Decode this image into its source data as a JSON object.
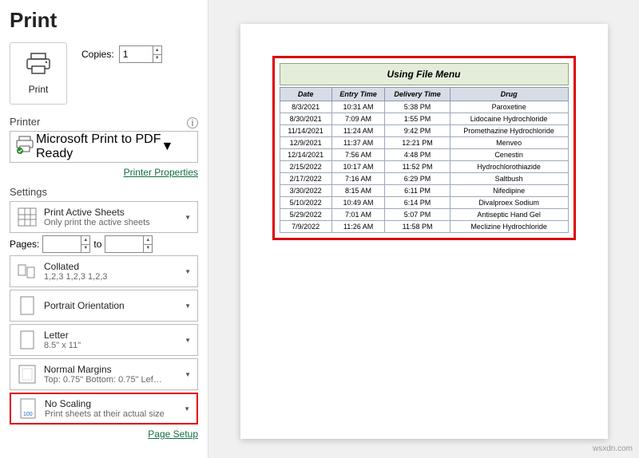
{
  "title": "Print",
  "print_button": "Print",
  "copies_label": "Copies:",
  "copies_value": "1",
  "printer_section": "Printer",
  "printer": {
    "name": "Microsoft Print to PDF",
    "status": "Ready"
  },
  "printer_properties_link": "Printer Properties",
  "settings_section": "Settings",
  "active_sheets": {
    "title": "Print Active Sheets",
    "sub": "Only print the active sheets"
  },
  "pages_label": "Pages:",
  "pages_to": "to",
  "collated": {
    "title": "Collated",
    "sub": "1,2,3   1,2,3   1,2,3"
  },
  "orientation": {
    "title": "Portrait Orientation"
  },
  "paper": {
    "title": "Letter",
    "sub": "8.5\" x 11\""
  },
  "margins": {
    "title": "Normal Margins",
    "sub": "Top: 0.75\" Bottom: 0.75\" Lef…"
  },
  "scaling": {
    "title": "No Scaling",
    "sub": "Print sheets at their actual size"
  },
  "page_setup_link": "Page Setup",
  "preview": {
    "title": "Using File Menu",
    "headers": [
      "Date",
      "Entry Time",
      "Delivery Time",
      "Drug"
    ],
    "rows": [
      [
        "8/3/2021",
        "10:31 AM",
        "5:38 PM",
        "Paroxetine"
      ],
      [
        "8/30/2021",
        "7:09 AM",
        "1:55 PM",
        "Lidocaine Hydrochloride"
      ],
      [
        "11/14/2021",
        "11:24 AM",
        "9:42 PM",
        "Promethazine Hydrochloride"
      ],
      [
        "12/9/2021",
        "11:37 AM",
        "12:21 PM",
        "Menveo"
      ],
      [
        "12/14/2021",
        "7:56 AM",
        "4:48 PM",
        "Cenestin"
      ],
      [
        "2/15/2022",
        "10:17 AM",
        "11:52 PM",
        "Hydrochlorothiazide"
      ],
      [
        "2/17/2022",
        "7:16 AM",
        "6:29 PM",
        "Saltbush"
      ],
      [
        "3/30/2022",
        "8:15 AM",
        "6:11 PM",
        "Nifedipine"
      ],
      [
        "5/10/2022",
        "10:49 AM",
        "6:14 PM",
        "Divalproex Sodium"
      ],
      [
        "5/29/2022",
        "7:01 AM",
        "5:07 PM",
        "Antiseptic Hand Gel"
      ],
      [
        "7/9/2022",
        "11:26 AM",
        "11:58 PM",
        "Meclizine Hydrochloride"
      ]
    ]
  },
  "watermark": "wsxdn.com"
}
